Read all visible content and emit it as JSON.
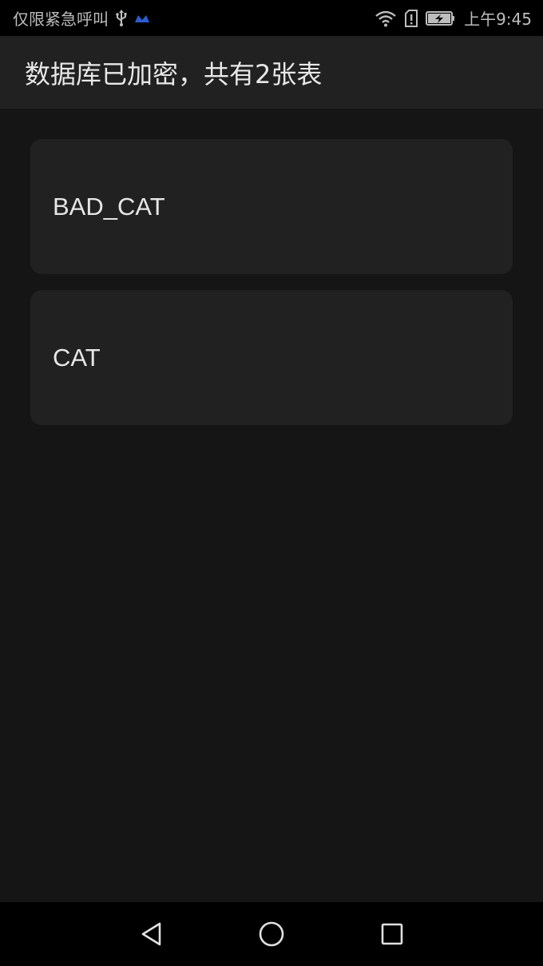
{
  "status_bar": {
    "carrier_text": "仅限紧急呼叫",
    "time": "上午9:45",
    "icons": [
      "usb-icon",
      "notification-app-icon",
      "wifi-icon",
      "sim-alert-icon",
      "battery-charging-icon"
    ],
    "notification_icon_color": "#2c5ccf"
  },
  "toolbar": {
    "title": "数据库已加密，共有2张表"
  },
  "tables": [
    {
      "name": "BAD_CAT"
    },
    {
      "name": "CAT"
    }
  ],
  "nav_bar": {
    "icons": [
      "back-icon",
      "home-icon",
      "recent-apps-icon"
    ]
  },
  "colors": {
    "background": "#151515",
    "toolbar": "#212121",
    "card": "#212121",
    "text": "#e6e6e6",
    "status_bar": "#000000"
  }
}
